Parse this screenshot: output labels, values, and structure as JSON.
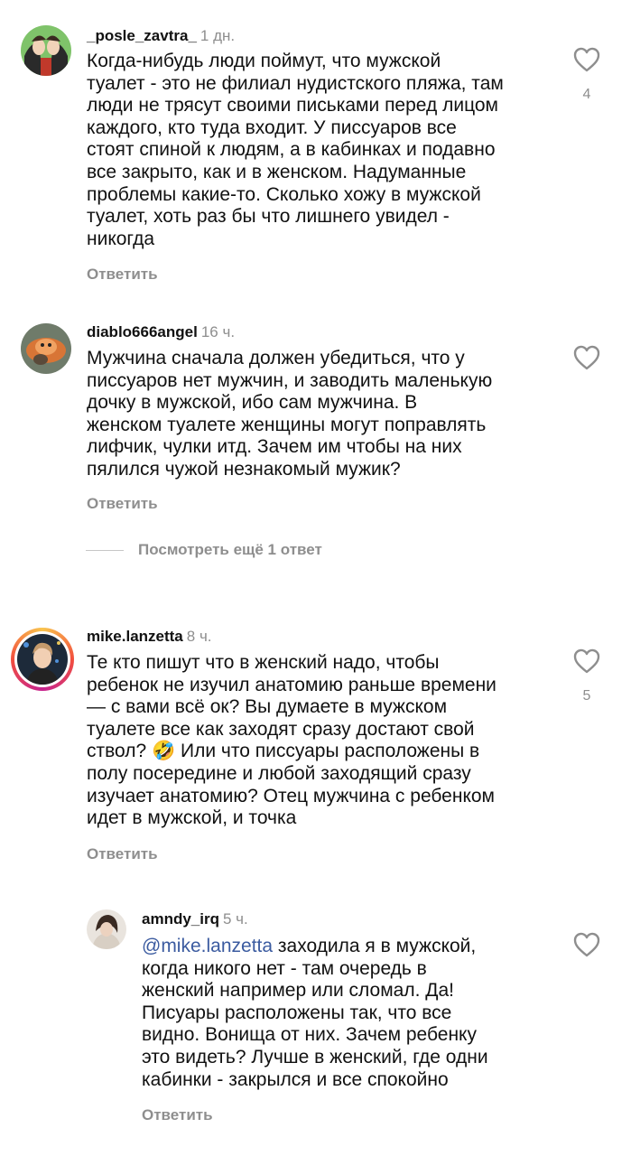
{
  "comments": [
    {
      "username": "_posle_zavtra_",
      "time": "1 дн.",
      "text": "Когда-нибудь люди поймут, что мужской\nтуалет - это не филиал нудистского пляжа, там\nлюди не трясут своими письками перед лицом\nкаждого, кто туда входит. У писсуаров все\nстоят спиной к людям, а в кабинках и подавно\nвсе закрыто, как и в женском. Надуманные\nпроблемы какие-то. Сколько хожу в мужской\nтуалет, хоть раз бы что лишнего увидел -\nникогда",
      "reply_label": "Ответить",
      "likes": "4",
      "icon": "heart-outline-icon"
    },
    {
      "username": "diablo666angel",
      "time": "16 ч.",
      "text": "Мужчина сначала должен убедиться, что у\nписсуаров нет мужчин, и заводить маленькую\nдочку в мужской, ибо сам мужчина. В\nженском туалете женщины могут поправлять\nлифчик, чулки итд. Зачем им чтобы на них\nпялился чужой незнакомый мужик?",
      "reply_label": "Ответить",
      "likes": "",
      "icon": "heart-outline-icon"
    },
    {
      "username": "mike.lanzetta",
      "time": "8 ч.",
      "text": "Те кто пишут что в женский надо, чтобы\nребенок не изучил анатомию раньше времени\n— с вами всё ок? Вы думаете в мужском\nтуалете все как заходят сразу достают свой\nствол? 🤣 Или что писсуары расположены в\nполу посередине и любой заходящий сразу\nизучает анатомию? Отец мужчина с ребенком\nидет в мужской, и точка",
      "reply_label": "Ответить",
      "likes": "5",
      "icon": "heart-outline-icon"
    },
    {
      "username": "amndy_irq",
      "time": "5 ч.",
      "mention": "@mike.lanzetta",
      "text": " заходила я в мужской,\nкогда никого нет - там очередь в\nженский например или сломал. Да!\nПисуары расположены так, что все\nвидно. Вонища от них. Зачем ребенку\nэто видеть? Лучше в женский, где одни\nкабинки - закрылся и все спокойно",
      "reply_label": "Ответить",
      "likes": "",
      "icon": "heart-outline-icon"
    }
  ],
  "more_replies_label": "Посмотреть ещё 1 ответ",
  "colors": {
    "text": "#111111",
    "muted": "#8e8e8e",
    "mention": "#3b5ba0",
    "story_ring": "#c6238f"
  }
}
